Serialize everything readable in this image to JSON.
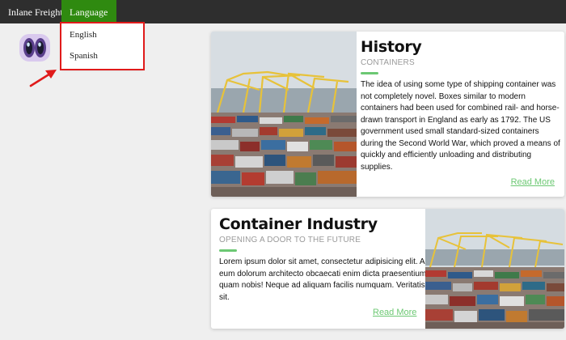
{
  "navbar": {
    "brand": "Inlane Freight",
    "language_label": "Language",
    "background": "#2e2e2e",
    "accent": "#2f8a10"
  },
  "dropdown": {
    "items": [
      "English",
      "Spanish"
    ],
    "highlight_color": "#e01b1b"
  },
  "cards": [
    {
      "title": "History",
      "subtitle": "CONTAINERS",
      "body": "The idea of using some type of shipping container was not completely novel. Boxes similar to modern containers had been used for combined rail- and horse-drawn transport in England as early as 1792. The US government used small standard-sized containers during the Second World War, which proved a means of quickly and efficiently unloading and distributing supplies.",
      "link": "Read More"
    },
    {
      "title": "Container Industry",
      "subtitle": "OPENING A DOOR TO THE FUTURE",
      "body": "Lorem ipsum dolor sit amet, consectetur adipisicing elit. Ad eum dolorum architecto obcaecati enim dicta praesentium, quam nobis! Neque ad aliquam facilis numquam. Veritatis, sit.",
      "link": "Read More"
    }
  ],
  "colors": {
    "link": "#6cc873",
    "page_background": "#efefef"
  }
}
